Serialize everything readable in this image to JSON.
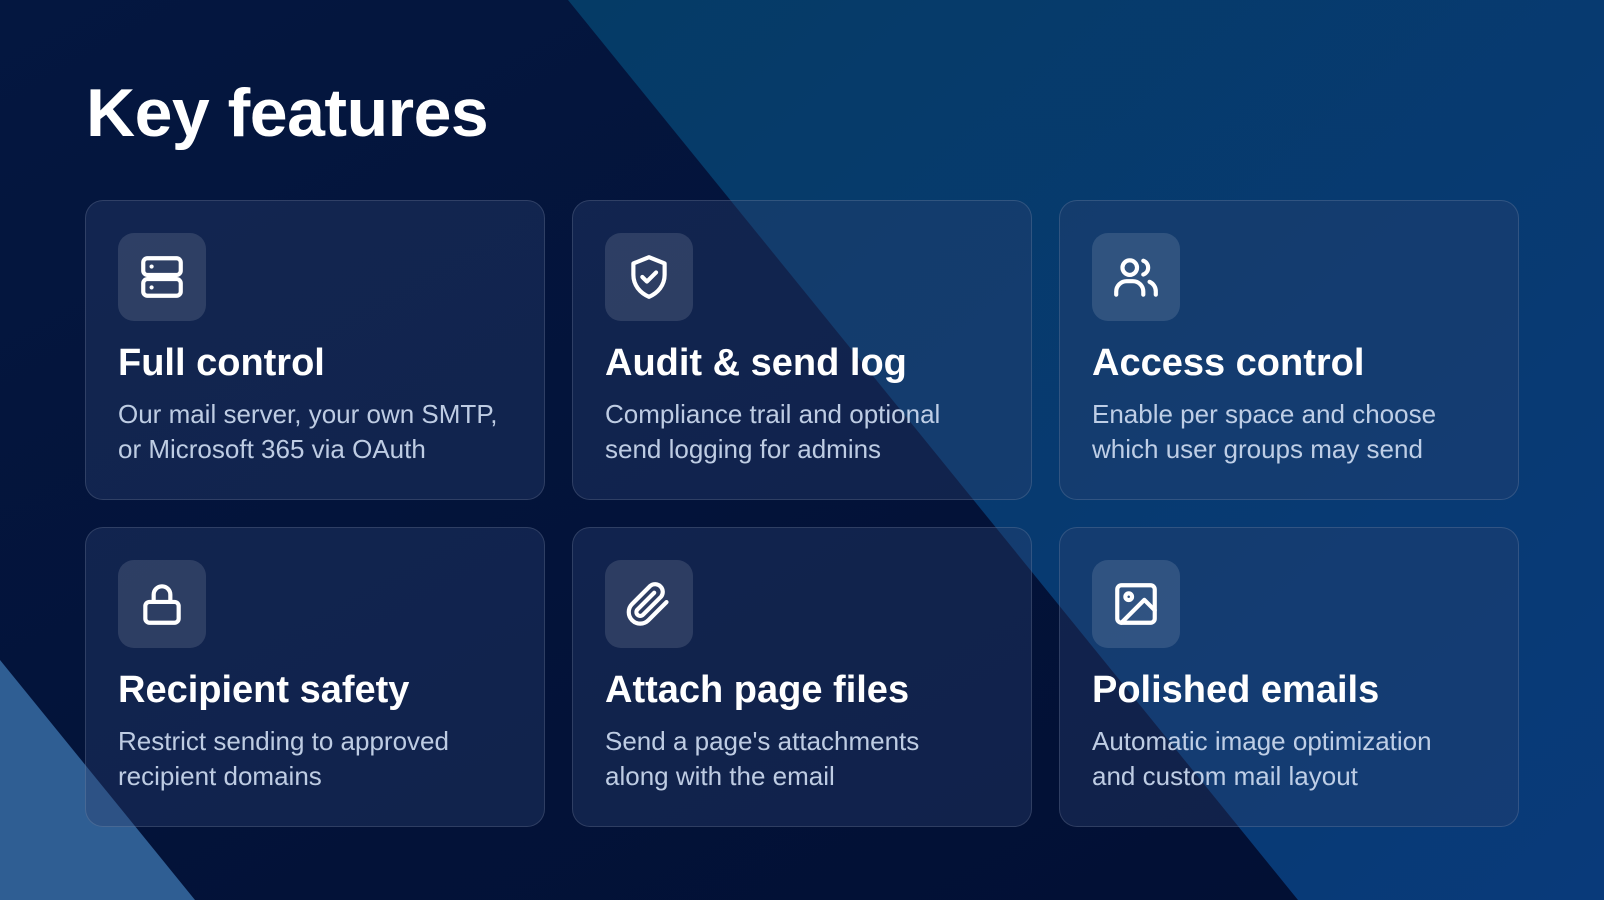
{
  "title": "Key features",
  "colors": {
    "background_dark": "#03123a",
    "background_light": "#0c3f78",
    "accent_triangle": "#2f5e93",
    "card_fill": "rgba(42,64,110,0.38)",
    "text_primary": "#ffffff",
    "text_secondary": "#cddbf0"
  },
  "features": [
    {
      "icon": "server-icon",
      "title": "Full control",
      "description": "Our mail server, your own SMTP,\nor Microsoft 365 via OAuth"
    },
    {
      "icon": "shield-check-icon",
      "title": "Audit & send log",
      "description": "Compliance trail and optional\nsend logging for admins"
    },
    {
      "icon": "users-icon",
      "title": "Access control",
      "description": "Enable per space and choose\nwhich user groups may send"
    },
    {
      "icon": "lock-icon",
      "title": "Recipient safety",
      "description": "Restrict sending to approved\nrecipient domains"
    },
    {
      "icon": "paperclip-icon",
      "title": "Attach page files",
      "description": "Send a page's attachments\nalong with the email"
    },
    {
      "icon": "image-icon",
      "title": "Polished emails",
      "description": "Automatic image optimization\nand custom mail layout"
    }
  ]
}
